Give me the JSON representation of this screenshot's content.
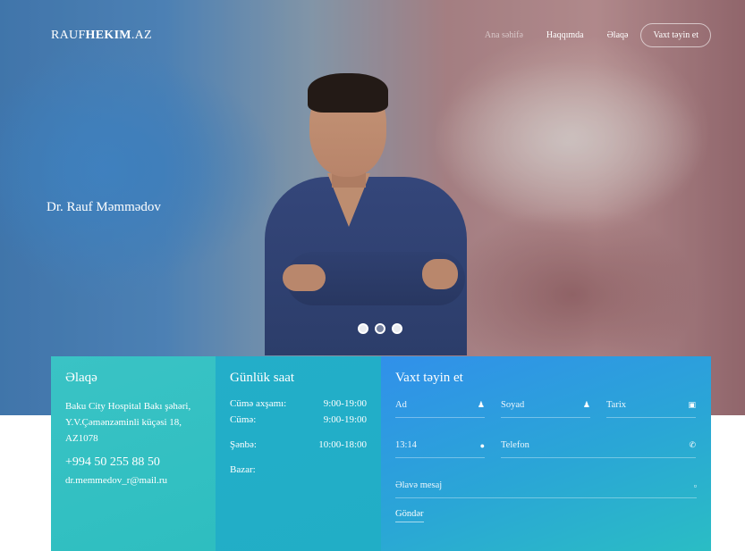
{
  "brand": {
    "part1": "RAUF",
    "part2": "HEKIM",
    "part3": ".AZ"
  },
  "nav": {
    "items": [
      {
        "label": "Ana səhifə",
        "active": true
      },
      {
        "label": "Haqqımda",
        "active": false
      },
      {
        "label": "Əlaqə",
        "active": false
      }
    ],
    "cta_label": "Vaxt təyin et"
  },
  "hero": {
    "doctor_name": "Dr. Rauf Məmmədov",
    "slider_active_index": 1,
    "slider_count": 3
  },
  "contact": {
    "title": "Əlaqə",
    "address_line1": "Baku City Hospital Bakı şəhəri,",
    "address_line2": "Y.V.Çəmənzəminli küçəsi 18,",
    "address_line3": "AZ1078",
    "phone": "+994 50 255 88 50",
    "email": "dr.memmedov_r@mail.ru"
  },
  "hours": {
    "title": "Günlük saat",
    "rows": [
      {
        "day": "Cümə axşamı:",
        "time": "9:00-19:00"
      },
      {
        "day": "Cümə:",
        "time": "9:00-19:00"
      },
      {
        "day": "Şənbə:",
        "time": "10:00-18:00"
      },
      {
        "day": "Bazar:",
        "time": ""
      }
    ]
  },
  "appointment": {
    "title": "Vaxt təyin et",
    "fields": {
      "name": "Ad",
      "surname": "Soyad",
      "date": "Tarix",
      "time": "13:14",
      "phone": "Telefon",
      "message": "Əlavə mesaj"
    },
    "submit_label": "Göndər"
  },
  "colors": {
    "panel_contact": "#3ac3c5",
    "panel_hours": "#23aec9",
    "panel_form": "#3190ea"
  }
}
